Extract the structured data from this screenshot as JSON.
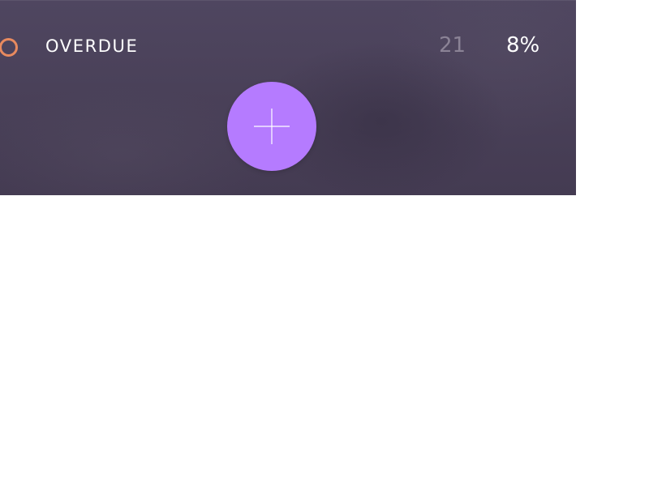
{
  "status_row": {
    "label": "OVERDUE",
    "count": "21",
    "percent": "8%",
    "indicator_color": "#e88a5f"
  },
  "fab": {
    "icon": "plus-icon",
    "color": "#b57bff"
  },
  "theme": {
    "panel_color": "#4a4159",
    "label_color": "#ffffff",
    "count_color": "#8b8396"
  }
}
